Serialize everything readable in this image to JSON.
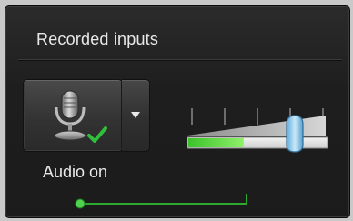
{
  "panel": {
    "title": "Recorded inputs"
  },
  "audio": {
    "status_label": "Audio on",
    "enabled": true,
    "icons": {
      "main": "microphone-icon",
      "status": "checkmark-icon",
      "dropdown": "dropdown-arrow-icon"
    },
    "volume_level": 0.77,
    "input_meter_level": 0.4
  },
  "colors": {
    "panel_background": "#1e1e1e",
    "text": "#e8e8e8",
    "accent_green": "#2ea82e",
    "meter_green": "#5fd93b",
    "thumb_blue": "#8fc8ea"
  }
}
